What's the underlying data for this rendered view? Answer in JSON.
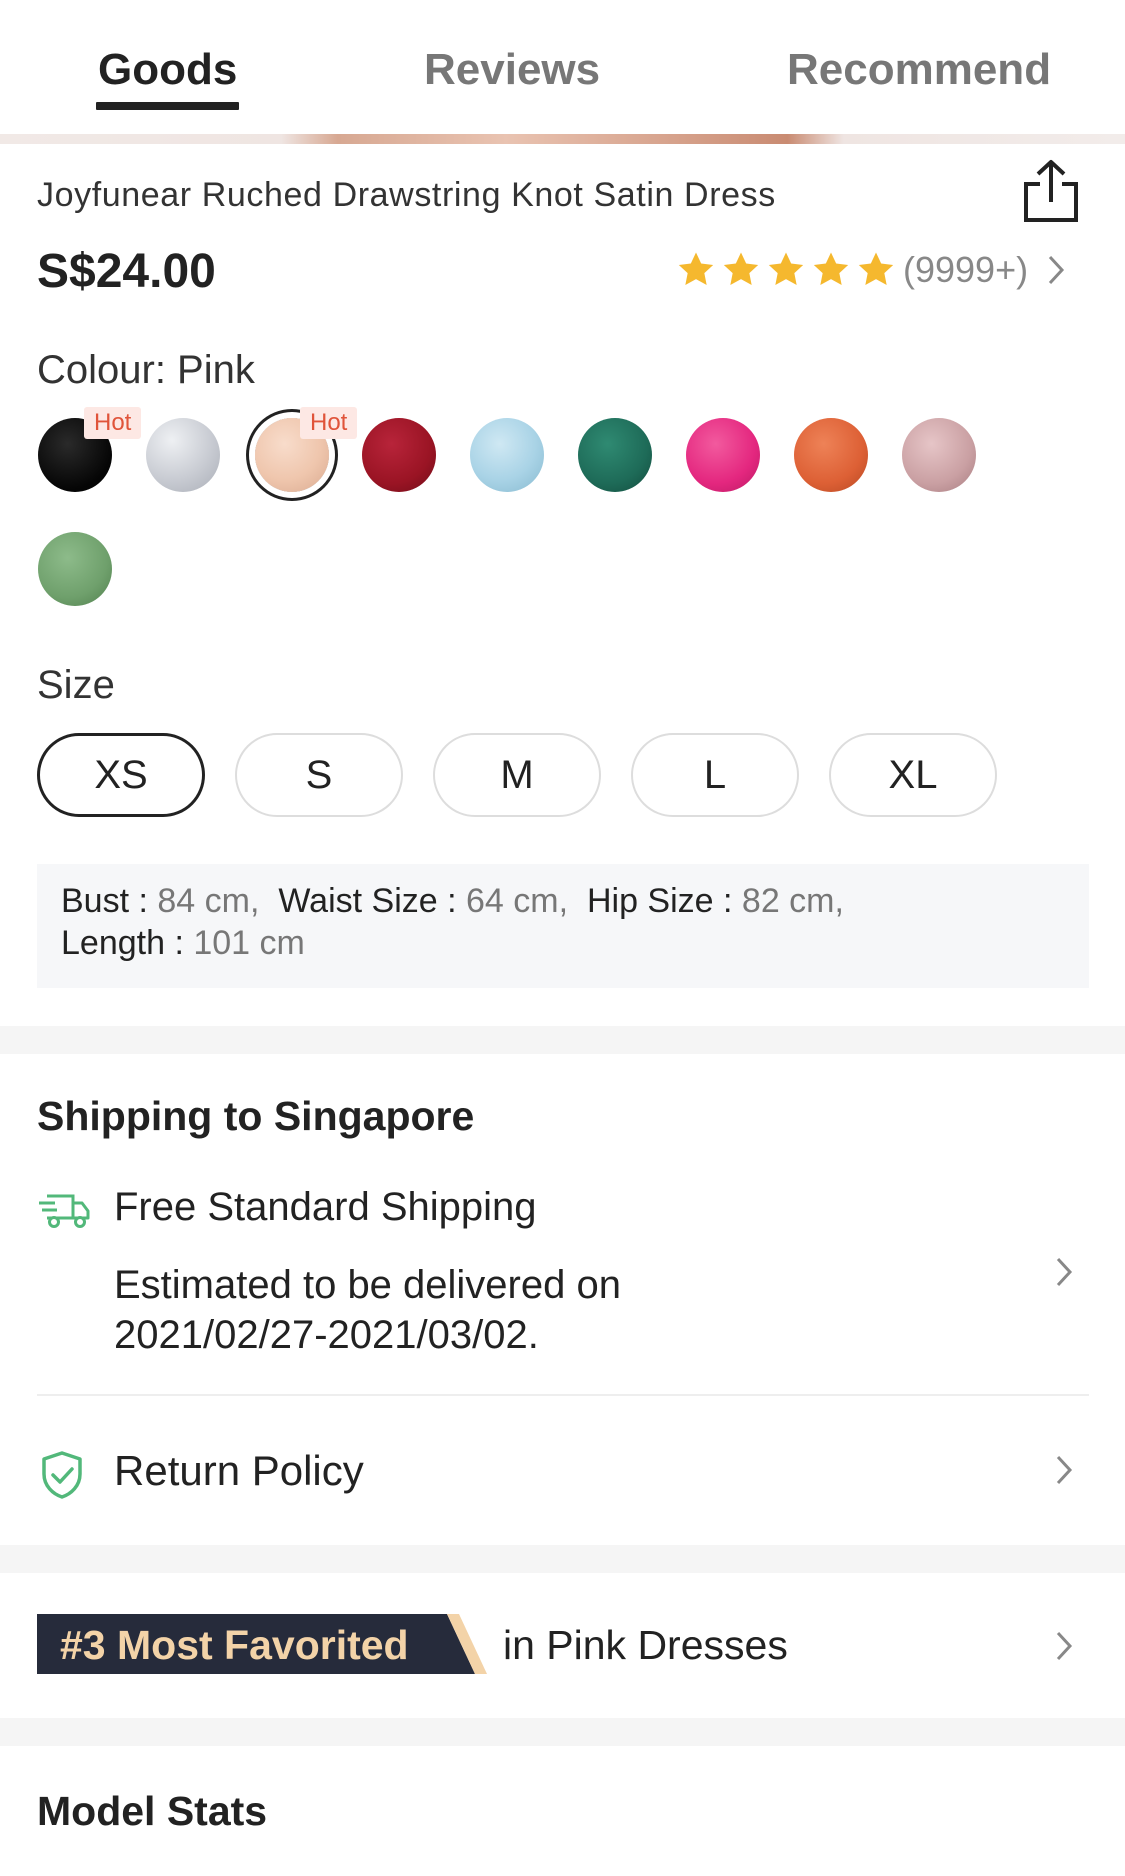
{
  "tabs": [
    {
      "label": "Goods",
      "active": true
    },
    {
      "label": "Reviews",
      "active": false
    },
    {
      "label": "Recommend",
      "active": false
    }
  ],
  "product": {
    "title": "Joyfunear Ruched Drawstring Knot Satin Dress",
    "price": "S$24.00",
    "rating_stars": 5,
    "rating_count": "(9999+)"
  },
  "colour": {
    "label": "Colour: Pink",
    "hot_badge": "Hot",
    "swatches": [
      {
        "name": "black",
        "color": "#0c0c0c",
        "hot": true
      },
      {
        "name": "silver",
        "color": "#c9ccd3",
        "hot": false
      },
      {
        "name": "pink",
        "color": "#efc6ad",
        "hot": true,
        "selected": true
      },
      {
        "name": "burgundy",
        "color": "#9a1424",
        "hot": false
      },
      {
        "name": "light-blue",
        "color": "#a9d3e6",
        "hot": false
      },
      {
        "name": "dark-green",
        "color": "#1e6b58",
        "hot": false
      },
      {
        "name": "hot-pink",
        "color": "#e4277f",
        "hot": false
      },
      {
        "name": "orange",
        "color": "#dd6035",
        "hot": false
      },
      {
        "name": "mauve",
        "color": "#caa0a3",
        "hot": false
      },
      {
        "name": "sage-green",
        "color": "#6fa06c",
        "hot": false
      }
    ]
  },
  "size": {
    "label": "Size",
    "options": [
      "XS",
      "S",
      "M",
      "L",
      "XL"
    ],
    "selected": "XS"
  },
  "measurements": {
    "bust_label": "Bust :",
    "bust_value": "84 cm,",
    "waist_label": "Waist Size :",
    "waist_value": "64 cm,",
    "hip_label": "Hip Size :",
    "hip_value": "82 cm,",
    "length_label": "Length :",
    "length_value": "101 cm"
  },
  "shipping": {
    "title": "Shipping to Singapore",
    "method": "Free Standard Shipping",
    "estimate": "Estimated to be delivered on 2021/02/27-2021/03/02.",
    "return_policy": "Return Policy"
  },
  "ranking": {
    "badge": "#3 Most Favorited",
    "suffix": "in Pink Dresses"
  },
  "model_stats": {
    "title": "Model Stats"
  },
  "colors": {
    "star": "#f5b82e",
    "green_icon": "#52b87a",
    "badge_bg": "#262b3b",
    "badge_text": "#f3d3a8"
  }
}
